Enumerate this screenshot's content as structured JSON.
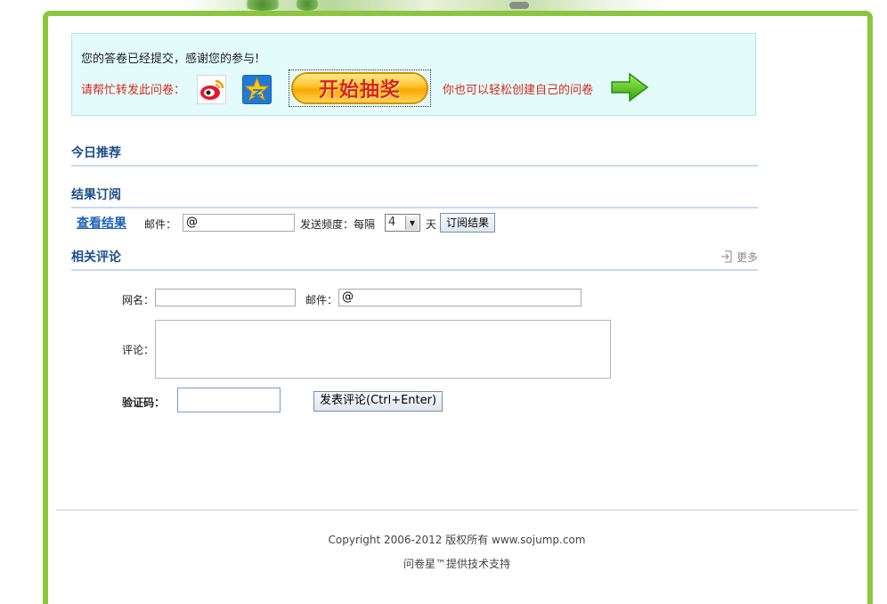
{
  "notice": {
    "thanks": "您的答卷已经提交，感谢您的参与!",
    "share_label": "请帮忙转发此问卷：",
    "lottery_label": "开始抽奖",
    "create_label": "你也可以轻松创建自己的问卷"
  },
  "sections": {
    "recommend_title": "今日推荐",
    "subscribe_title": "结果订阅",
    "comments_title": "相关评论",
    "more_label": "更多"
  },
  "subscribe": {
    "view_results": "查看结果",
    "email_label": "邮件：",
    "email_value": "@",
    "frequency_label": "发送频度：每隔",
    "frequency_value": "4",
    "days_label": "天",
    "subscribe_button": "订阅结果"
  },
  "comment_form": {
    "name_label": "网名：",
    "name_value": "",
    "email_label": "邮件：",
    "email_value": "@",
    "comment_label": "评论：",
    "captcha_label": "验证码：",
    "captcha_value": "",
    "submit_button": "发表评论(Ctrl+Enter)"
  },
  "footer": {
    "copyright": "Copyright 2006-2012 版权所有 www.sojump.com",
    "powered_by": "问卷星™提供技术支持"
  },
  "colors": {
    "frame_border": "#8cc63f",
    "notice_bg": "#e3fbfb",
    "red_text": "#d42a1d",
    "section_title": "#1d4e89"
  }
}
